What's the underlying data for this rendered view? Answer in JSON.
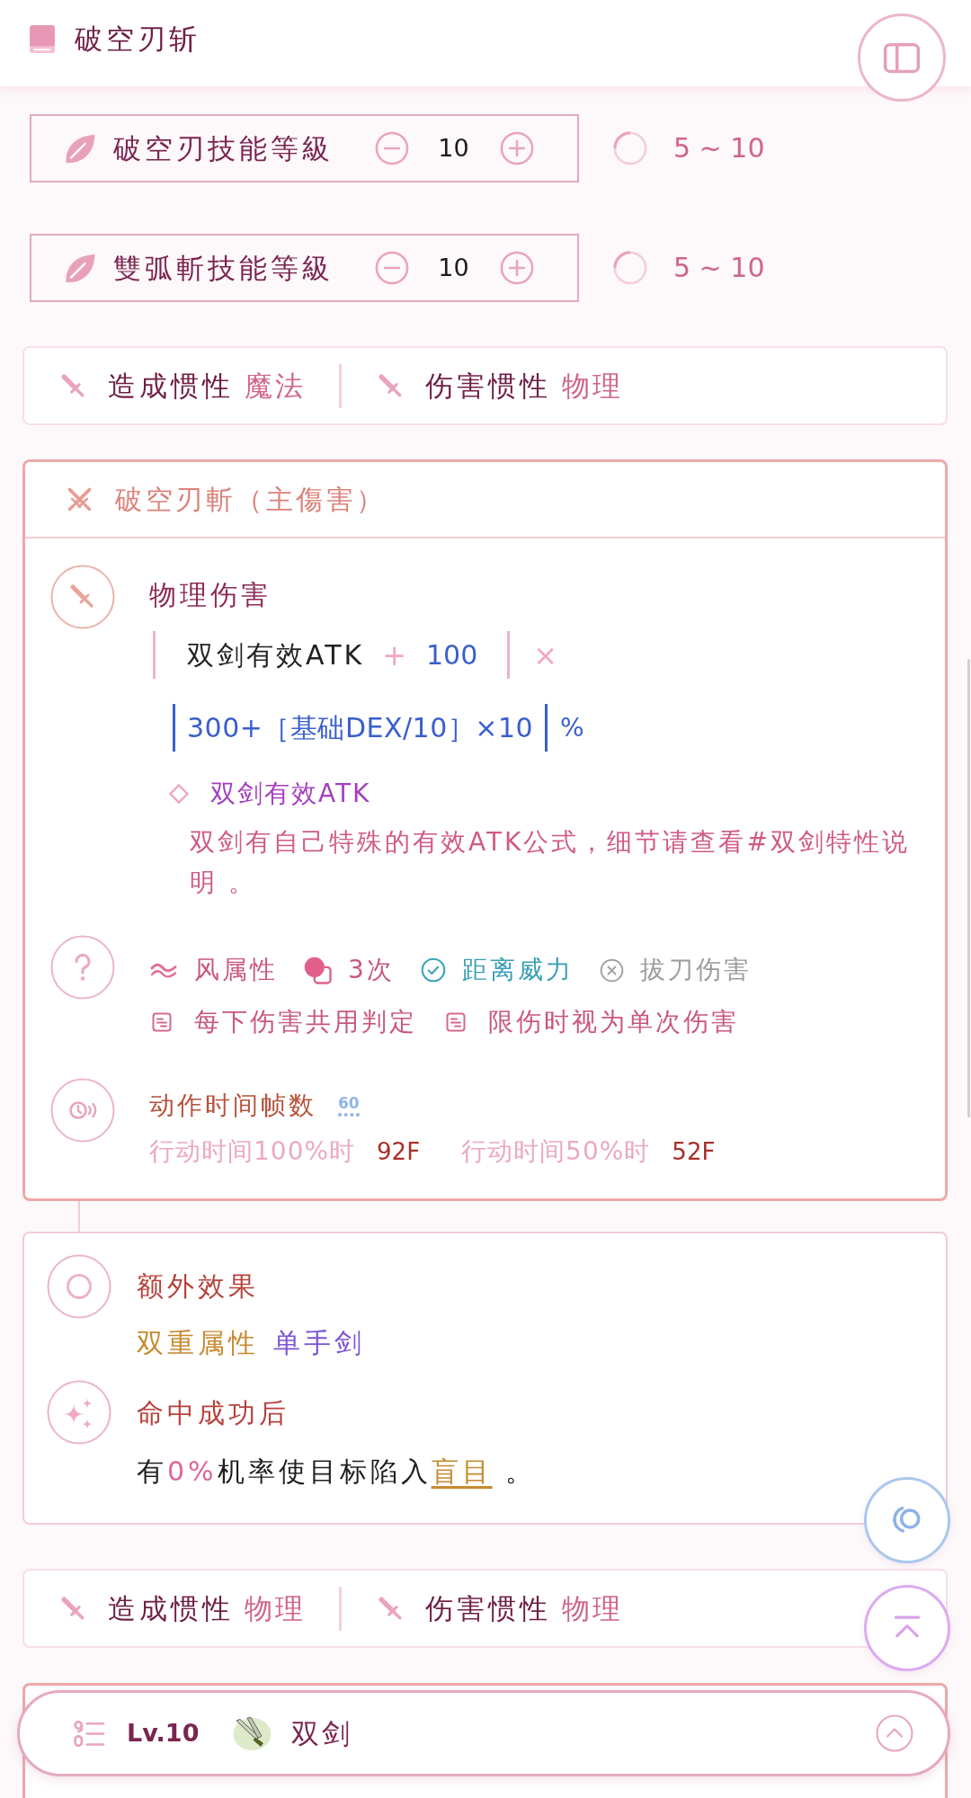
{
  "header": {
    "title": "破空刃斩"
  },
  "skill_levels": [
    {
      "label": "破空刃技能等級",
      "value": "10",
      "range": "5 ~ 10"
    },
    {
      "label": "雙弧斬技能等級",
      "value": "10",
      "range": "5 ~ 10"
    }
  ],
  "sections": [
    {
      "kind": "inertia",
      "items": [
        {
          "label": "造成惯性",
          "value": "魔法"
        },
        {
          "label": "伤害惯性",
          "value": "物理"
        }
      ]
    },
    {
      "kind": "damage",
      "title": "破空刃斬（主傷害）",
      "damage": {
        "label": "物理伤害",
        "formula": {
          "base": "双剑有效ATK",
          "plus": "+",
          "constant": "100",
          "times": "×",
          "multiplier": "300+［基础DEX/10］×10",
          "unit": "%"
        }
      },
      "note": {
        "term": "双剑有效ATK",
        "text": "双剑有自己特殊的有效ATK公式，细节请查看#双剑特性说明 。"
      },
      "properties": [
        [
          {
            "kind": "element",
            "text": "风属性"
          },
          {
            "kind": "hits",
            "text": "3次"
          },
          {
            "kind": "toggle",
            "text": "距离威力",
            "checked": true
          },
          {
            "kind": "toggle",
            "text": "拔刀伤害",
            "checked": false
          }
        ],
        [
          {
            "kind": "note",
            "text": "每下伤害共用判定"
          },
          {
            "kind": "note",
            "text": "限伤时视为单次伤害"
          }
        ]
      ],
      "frames": {
        "label": "动作时间帧数",
        "badge": "60",
        "items": [
          {
            "label": "行动时间100%时",
            "value": "92F"
          },
          {
            "label": "行动时间50%时",
            "value": "52F"
          }
        ]
      }
    },
    {
      "kind": "effects",
      "title": "额外效果",
      "tags": [
        {
          "text": "双重属性",
          "color": "#c68a30"
        },
        {
          "text": "单手剑",
          "color": "#7c55d6"
        }
      ],
      "trigger": "命中成功后",
      "sentence": [
        {
          "kind": "text",
          "text": "有"
        },
        {
          "kind": "value",
          "text": "0%"
        },
        {
          "kind": "text",
          "text": "机率使目标陷入"
        },
        {
          "kind": "link",
          "text": "盲目"
        },
        {
          "kind": "text",
          "text": "。"
        }
      ]
    },
    {
      "kind": "inertia",
      "items": [
        {
          "label": "造成惯性",
          "value": "物理"
        },
        {
          "label": "伤害惯性",
          "value": "物理"
        }
      ]
    },
    {
      "kind": "damage_stub"
    }
  ],
  "bottom_bar": {
    "level": "Lv.10",
    "weapon": "双剑"
  }
}
